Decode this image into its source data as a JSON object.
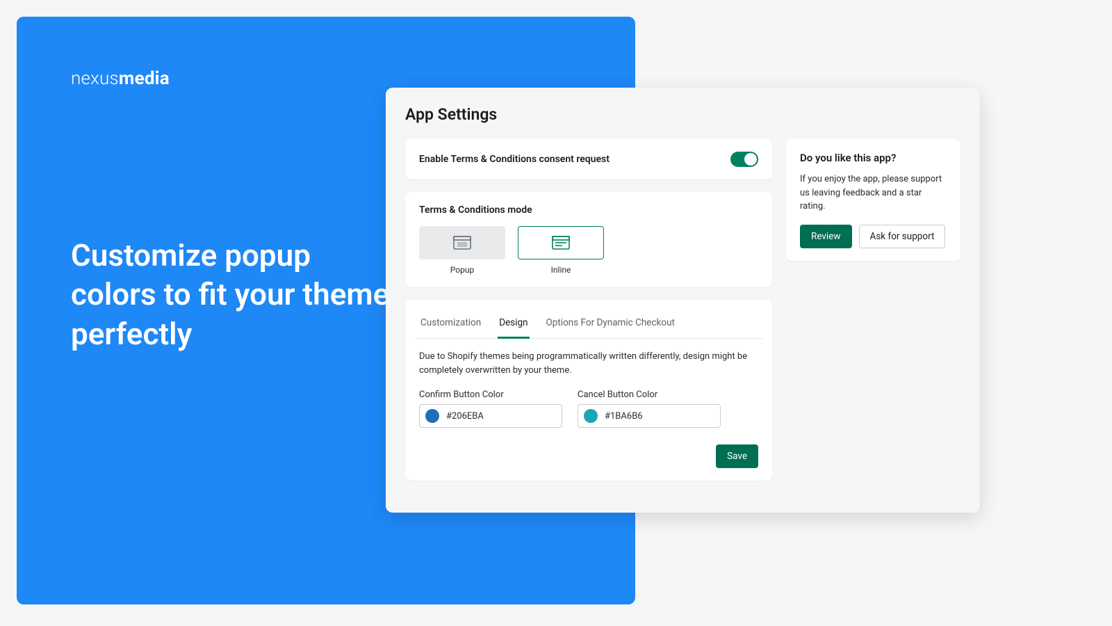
{
  "promo": {
    "logo_light": "nexus",
    "logo_bold": "media",
    "headline": "Customize popup colors to fit your theme perfectly"
  },
  "settings": {
    "title": "App Settings",
    "enable": {
      "label": "Enable Terms & Conditions consent request",
      "on": true
    },
    "mode": {
      "title": "Terms & Conditions mode",
      "options": [
        {
          "label": "Popup",
          "selected": false
        },
        {
          "label": "Inline",
          "selected": true
        }
      ]
    },
    "tabs": [
      {
        "label": "Customization",
        "active": false
      },
      {
        "label": "Design",
        "active": true
      },
      {
        "label": "Options For Dynamic Checkout",
        "active": false
      }
    ],
    "design": {
      "help_text": "Due to Shopify themes being programmatically written differently, design might be completely overwritten by your theme.",
      "confirm_label": "Confirm Button Color",
      "confirm_value": "#206EBA",
      "cancel_label": "Cancel Button Color",
      "cancel_value": "#1BA6B6"
    },
    "save_label": "Save"
  },
  "sidebar": {
    "title": "Do you like this app?",
    "text": "If you enjoy the app, please support us leaving feedback and a star rating.",
    "review_label": "Review",
    "support_label": "Ask for support"
  },
  "colors": {
    "accent_green": "#008060",
    "accent_green_dark": "#006e52"
  }
}
